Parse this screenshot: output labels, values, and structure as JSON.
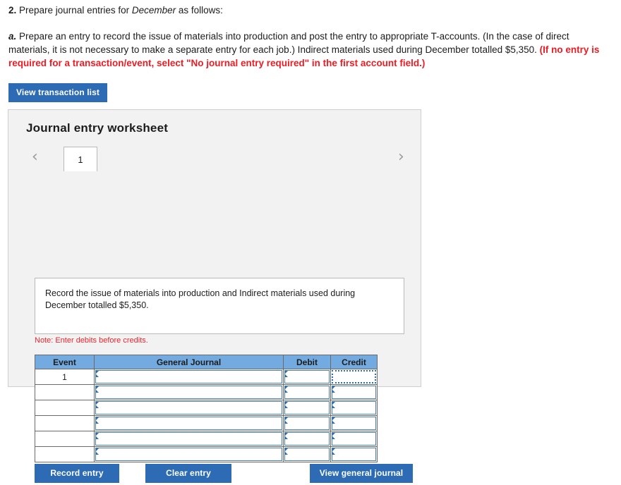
{
  "prompt": {
    "q_number": "2.",
    "q_text_before": " Prepare journal entries for ",
    "q_italic": "December",
    "q_text_after": " as follows:",
    "sub_letter": "a.",
    "sub_text": " Prepare an entry to record the issue of materials into production and post the entry to appropriate T-accounts. (In the case of direct materials, it is not necessary to make a separate entry for each job.) Indirect materials used during December totalled $5,350. ",
    "sub_red": "(If no entry is required for a transaction/event, select \"No journal entry required\" in the first account field.)"
  },
  "toolbar": {
    "view_transaction_list": "View transaction list"
  },
  "worksheet": {
    "title": "Journal entry worksheet",
    "prev_arrow": "‹",
    "next_arrow": "›",
    "tabs": [
      {
        "label": "1",
        "active": true
      }
    ],
    "description": "Record the issue of materials into production and Indirect materials used during December totalled $5,350.",
    "note": "Note: Enter debits before credits."
  },
  "table": {
    "headers": [
      "Event",
      "General Journal",
      "Debit",
      "Credit"
    ],
    "rows": [
      {
        "event": "1",
        "general_journal": "",
        "debit": "",
        "credit": ""
      },
      {
        "event": "",
        "general_journal": "",
        "debit": "",
        "credit": ""
      },
      {
        "event": "",
        "general_journal": "",
        "debit": "",
        "credit": ""
      },
      {
        "event": "",
        "general_journal": "",
        "debit": "",
        "credit": ""
      },
      {
        "event": "",
        "general_journal": "",
        "debit": "",
        "credit": ""
      },
      {
        "event": "",
        "general_journal": "",
        "debit": "",
        "credit": ""
      }
    ]
  },
  "actions": {
    "record_entry": "Record entry",
    "clear_entry": "Clear entry",
    "view_general_journal": "View general journal"
  },
  "colors": {
    "button_blue": "#2d6cb5",
    "table_header_blue": "#73aae0",
    "field_border_blue": "#4a7fb5",
    "alert_red": "#ec1c24",
    "note_red": "#e8262d",
    "panel_bg": "#f2f2f2"
  }
}
